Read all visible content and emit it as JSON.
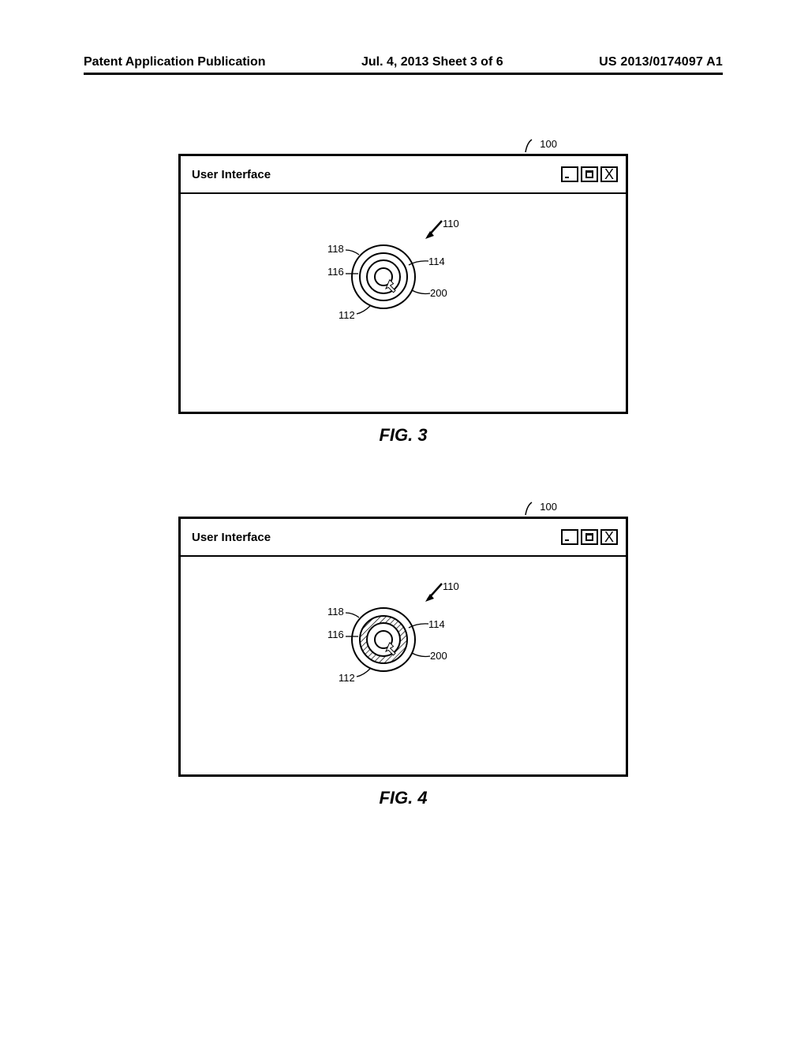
{
  "header": {
    "left": "Patent Application Publication",
    "center": "Jul. 4, 2013   Sheet 3 of 6",
    "right": "US 2013/0174097 A1"
  },
  "fig3": {
    "caption": "FIG. 3",
    "window_title": "User Interface",
    "refs": {
      "r100": "100",
      "r110": "110",
      "r118": "118",
      "r116": "116",
      "r114": "114",
      "r200": "200",
      "r112": "112"
    }
  },
  "fig4": {
    "caption": "FIG. 4",
    "window_title": "User Interface",
    "refs": {
      "r100": "100",
      "r110": "110",
      "r118": "118",
      "r116": "116",
      "r114": "114",
      "r200": "200",
      "r112": "112"
    }
  }
}
